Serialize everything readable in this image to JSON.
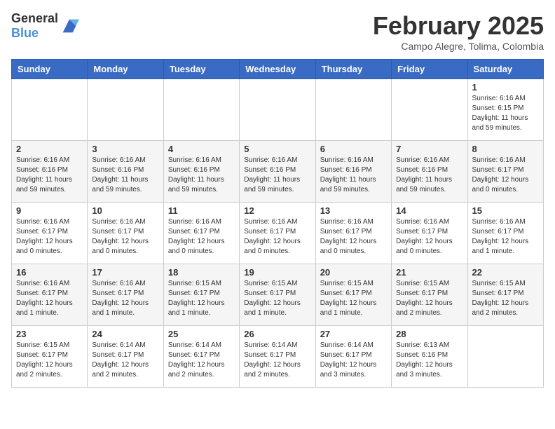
{
  "header": {
    "logo_general": "General",
    "logo_blue": "Blue",
    "month_title": "February 2025",
    "subtitle": "Campo Alegre, Tolima, Colombia"
  },
  "weekdays": [
    "Sunday",
    "Monday",
    "Tuesday",
    "Wednesday",
    "Thursday",
    "Friday",
    "Saturday"
  ],
  "weeks": [
    [
      {
        "day": "",
        "info": ""
      },
      {
        "day": "",
        "info": ""
      },
      {
        "day": "",
        "info": ""
      },
      {
        "day": "",
        "info": ""
      },
      {
        "day": "",
        "info": ""
      },
      {
        "day": "",
        "info": ""
      },
      {
        "day": "1",
        "info": "Sunrise: 6:16 AM\nSunset: 6:15 PM\nDaylight: 11 hours and 59 minutes."
      }
    ],
    [
      {
        "day": "2",
        "info": "Sunrise: 6:16 AM\nSunset: 6:16 PM\nDaylight: 11 hours and 59 minutes."
      },
      {
        "day": "3",
        "info": "Sunrise: 6:16 AM\nSunset: 6:16 PM\nDaylight: 11 hours and 59 minutes."
      },
      {
        "day": "4",
        "info": "Sunrise: 6:16 AM\nSunset: 6:16 PM\nDaylight: 11 hours and 59 minutes."
      },
      {
        "day": "5",
        "info": "Sunrise: 6:16 AM\nSunset: 6:16 PM\nDaylight: 11 hours and 59 minutes."
      },
      {
        "day": "6",
        "info": "Sunrise: 6:16 AM\nSunset: 6:16 PM\nDaylight: 11 hours and 59 minutes."
      },
      {
        "day": "7",
        "info": "Sunrise: 6:16 AM\nSunset: 6:16 PM\nDaylight: 11 hours and 59 minutes."
      },
      {
        "day": "8",
        "info": "Sunrise: 6:16 AM\nSunset: 6:17 PM\nDaylight: 12 hours and 0 minutes."
      }
    ],
    [
      {
        "day": "9",
        "info": "Sunrise: 6:16 AM\nSunset: 6:17 PM\nDaylight: 12 hours and 0 minutes."
      },
      {
        "day": "10",
        "info": "Sunrise: 6:16 AM\nSunset: 6:17 PM\nDaylight: 12 hours and 0 minutes."
      },
      {
        "day": "11",
        "info": "Sunrise: 6:16 AM\nSunset: 6:17 PM\nDaylight: 12 hours and 0 minutes."
      },
      {
        "day": "12",
        "info": "Sunrise: 6:16 AM\nSunset: 6:17 PM\nDaylight: 12 hours and 0 minutes."
      },
      {
        "day": "13",
        "info": "Sunrise: 6:16 AM\nSunset: 6:17 PM\nDaylight: 12 hours and 0 minutes."
      },
      {
        "day": "14",
        "info": "Sunrise: 6:16 AM\nSunset: 6:17 PM\nDaylight: 12 hours and 0 minutes."
      },
      {
        "day": "15",
        "info": "Sunrise: 6:16 AM\nSunset: 6:17 PM\nDaylight: 12 hours and 1 minute."
      }
    ],
    [
      {
        "day": "16",
        "info": "Sunrise: 6:16 AM\nSunset: 6:17 PM\nDaylight: 12 hours and 1 minute."
      },
      {
        "day": "17",
        "info": "Sunrise: 6:16 AM\nSunset: 6:17 PM\nDaylight: 12 hours and 1 minute."
      },
      {
        "day": "18",
        "info": "Sunrise: 6:15 AM\nSunset: 6:17 PM\nDaylight: 12 hours and 1 minute."
      },
      {
        "day": "19",
        "info": "Sunrise: 6:15 AM\nSunset: 6:17 PM\nDaylight: 12 hours and 1 minute."
      },
      {
        "day": "20",
        "info": "Sunrise: 6:15 AM\nSunset: 6:17 PM\nDaylight: 12 hours and 1 minute."
      },
      {
        "day": "21",
        "info": "Sunrise: 6:15 AM\nSunset: 6:17 PM\nDaylight: 12 hours and 2 minutes."
      },
      {
        "day": "22",
        "info": "Sunrise: 6:15 AM\nSunset: 6:17 PM\nDaylight: 12 hours and 2 minutes."
      }
    ],
    [
      {
        "day": "23",
        "info": "Sunrise: 6:15 AM\nSunset: 6:17 PM\nDaylight: 12 hours and 2 minutes."
      },
      {
        "day": "24",
        "info": "Sunrise: 6:14 AM\nSunset: 6:17 PM\nDaylight: 12 hours and 2 minutes."
      },
      {
        "day": "25",
        "info": "Sunrise: 6:14 AM\nSunset: 6:17 PM\nDaylight: 12 hours and 2 minutes."
      },
      {
        "day": "26",
        "info": "Sunrise: 6:14 AM\nSunset: 6:17 PM\nDaylight: 12 hours and 2 minutes."
      },
      {
        "day": "27",
        "info": "Sunrise: 6:14 AM\nSunset: 6:17 PM\nDaylight: 12 hours and 3 minutes."
      },
      {
        "day": "28",
        "info": "Sunrise: 6:13 AM\nSunset: 6:16 PM\nDaylight: 12 hours and 3 minutes."
      },
      {
        "day": "",
        "info": ""
      }
    ]
  ]
}
